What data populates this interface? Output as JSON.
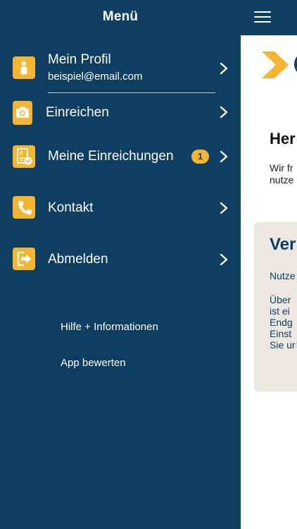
{
  "drawer": {
    "title": "Menü",
    "items": [
      {
        "label": "Mein Profil",
        "sub": "beispiel@email.com",
        "icon": "person-icon"
      },
      {
        "label": "Einreichen",
        "icon": "camera-icon"
      },
      {
        "label": "Meine Einreichungen",
        "icon": "receipt-check-icon",
        "badge": "1"
      },
      {
        "label": "Kontakt",
        "icon": "phone-icon"
      },
      {
        "label": "Abmelden",
        "icon": "logout-icon"
      }
    ],
    "footer": [
      {
        "label": "Hilfe + Informationen"
      },
      {
        "label": "App bewerten"
      }
    ]
  },
  "content": {
    "heading": "Her",
    "intro": [
      "Wir fr",
      "nutze"
    ],
    "card": {
      "heading": "Ver",
      "lines": [
        "Nutze",
        "",
        "Über",
        "ist ei",
        "Endg",
        "Einst",
        "Sie ur"
      ]
    }
  },
  "colors": {
    "navy": "#0e3f63",
    "accent": "#f6b52e",
    "card_bg": "#ece8e1"
  }
}
